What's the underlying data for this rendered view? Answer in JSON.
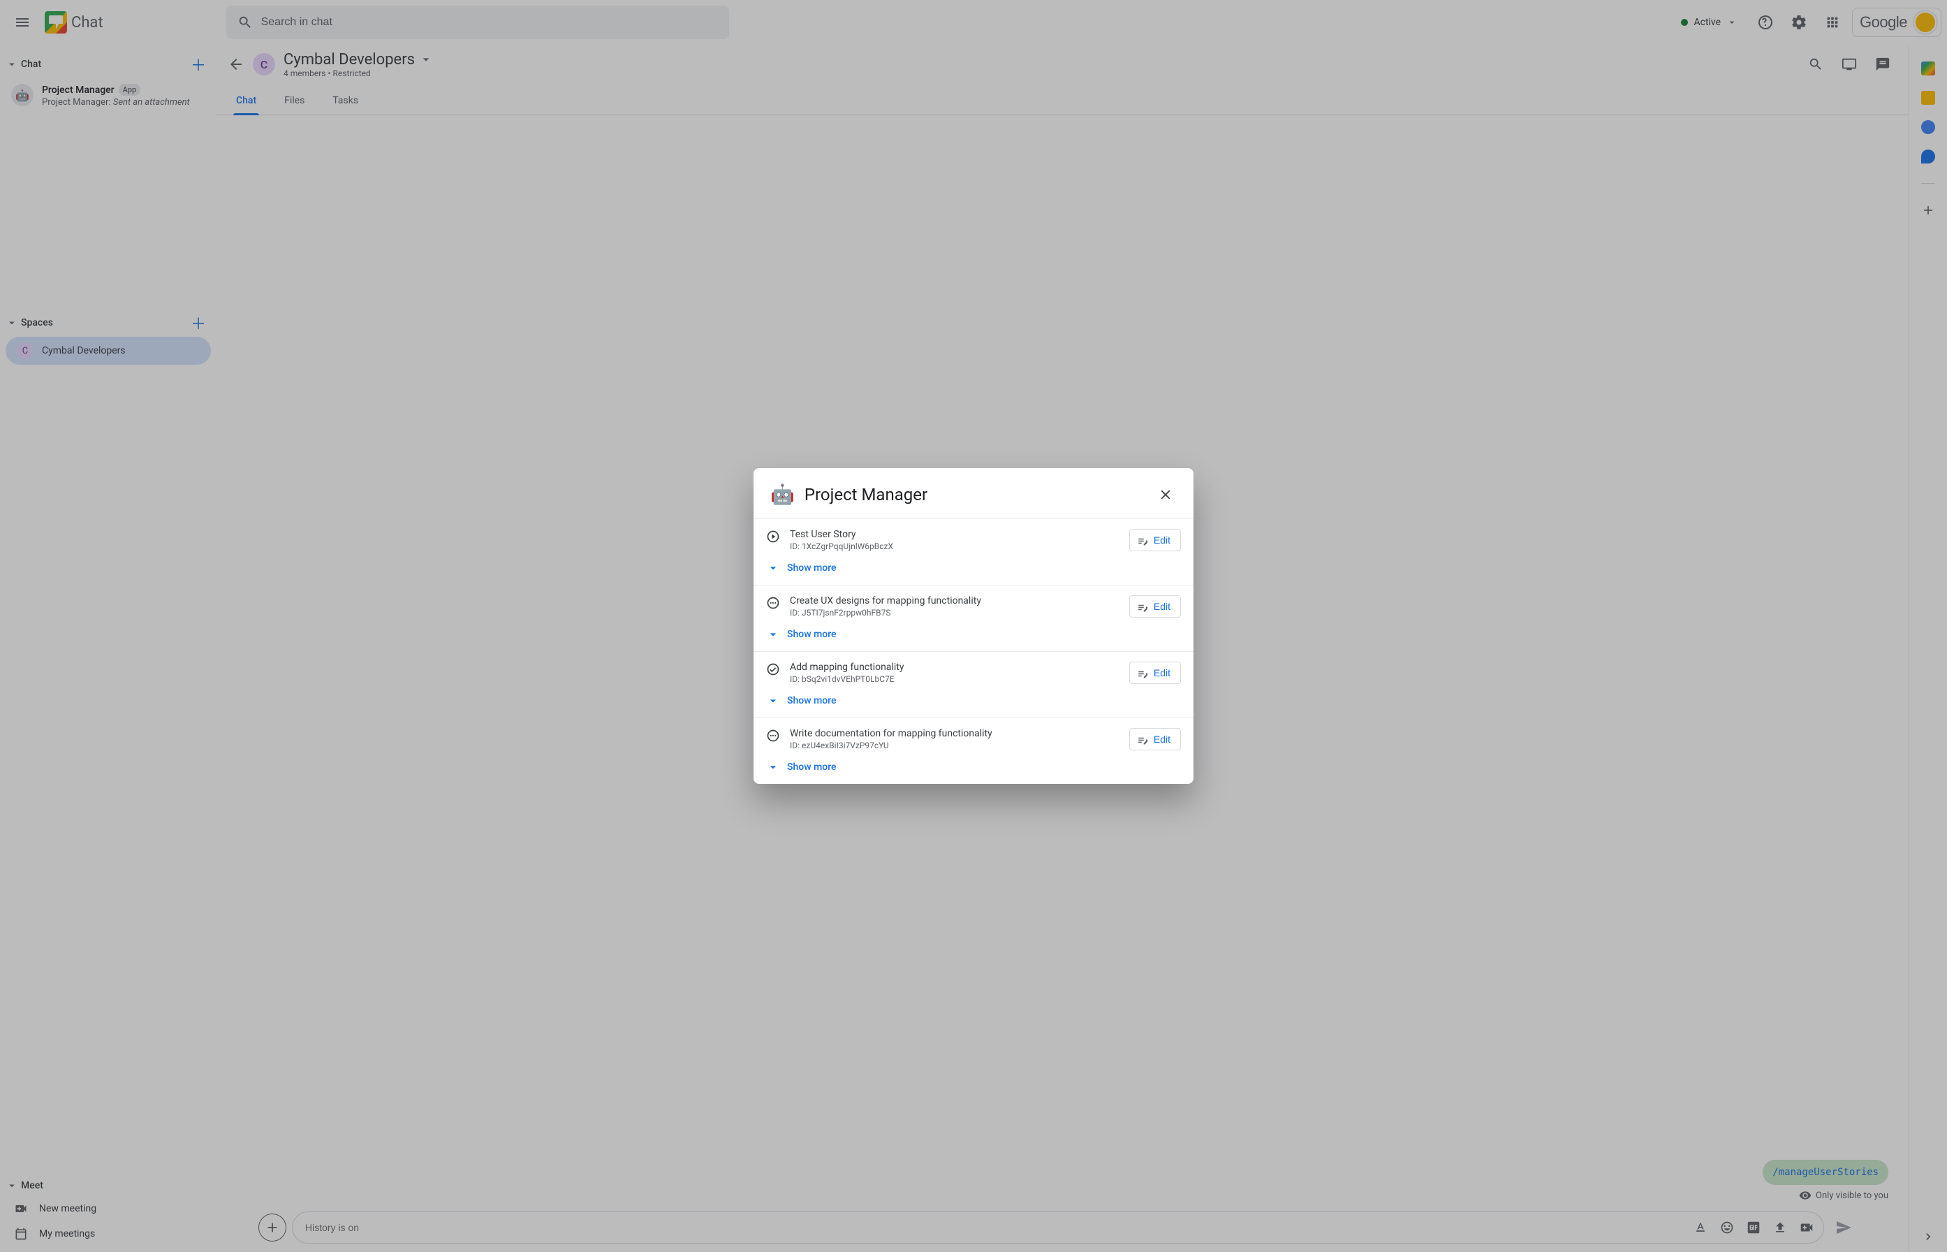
{
  "header": {
    "product": "Chat",
    "search_placeholder": "Search in chat",
    "status": "Active",
    "google": "Google"
  },
  "sidebar": {
    "chat_label": "Chat",
    "pm_item": {
      "title": "Project Manager",
      "chip": "App",
      "sub_prefix": "Project Manager: ",
      "sub_action": "Sent an attachment"
    },
    "spaces_label": "Spaces",
    "space": {
      "initial": "C",
      "name": "Cymbal Developers"
    },
    "meet_label": "Meet",
    "new_meeting": "New meeting",
    "my_meetings": "My meetings"
  },
  "conversation": {
    "initial": "C",
    "title": "Cymbal Developers",
    "sub": "4 members  •  Restricted",
    "tabs": {
      "chat": "Chat",
      "files": "Files",
      "tasks": "Tasks"
    },
    "slash_command": "/manageUserStories",
    "visible_text": "Only visible to you",
    "composer_placeholder": "History is on"
  },
  "dialog": {
    "title": "Project Manager",
    "edit_label": "Edit",
    "show_more": "Show more",
    "stories": [
      {
        "icon": "play",
        "title": "Test User Story",
        "id": "ID: 1XcZgrPqqUjnlW6pBczX"
      },
      {
        "icon": "dots",
        "title": "Create UX designs for mapping functionality",
        "id": "ID: J5TI7jsnF2rppw0hFB7S"
      },
      {
        "icon": "check",
        "title": "Add mapping functionality",
        "id": "ID: bSq2vi1dvVEhPT0LbC7E"
      },
      {
        "icon": "dots",
        "title": "Write documentation for mapping functionality",
        "id": "ID: ezU4exBiI3i7VzP97cYU"
      }
    ]
  }
}
